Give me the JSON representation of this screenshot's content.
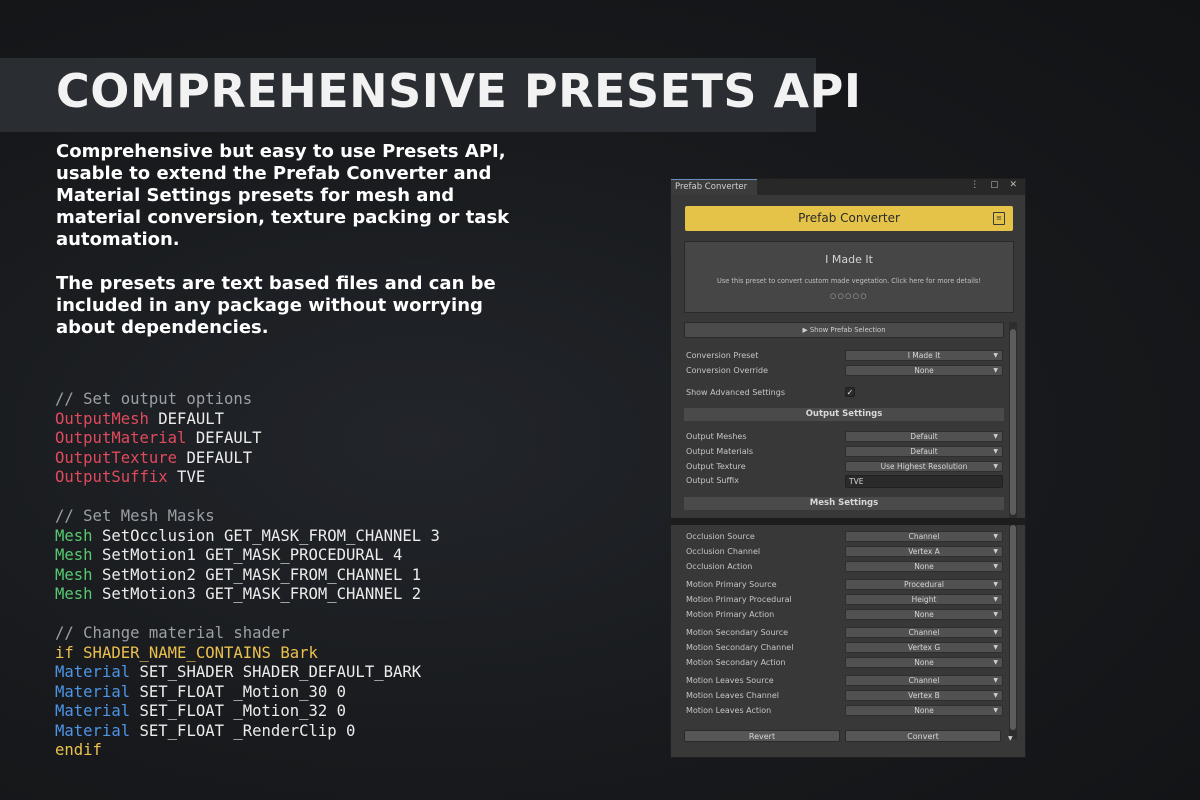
{
  "banner": {
    "title": "COMPREHENSIVE PRESETS API"
  },
  "description": {
    "paragraph1": "Comprehensive but easy to use Presets API, usable to extend the Prefab Converter and Material Settings presets for mesh and material conversion, texture packing or task automation.",
    "paragraph2": "The presets are text based files and can be included in any package without worrying about dependencies."
  },
  "code": [
    [
      {
        "t": "// Set output options",
        "c": "comment"
      }
    ],
    [
      {
        "t": "OutputMesh",
        "c": "red"
      },
      {
        "t": " DEFAULT",
        "c": "white"
      }
    ],
    [
      {
        "t": "OutputMaterial",
        "c": "red"
      },
      {
        "t": " DEFAULT",
        "c": "white"
      }
    ],
    [
      {
        "t": "OutputTexture",
        "c": "red"
      },
      {
        "t": " DEFAULT",
        "c": "white"
      }
    ],
    [
      {
        "t": "OutputSuffix",
        "c": "red"
      },
      {
        "t": " TVE",
        "c": "white"
      }
    ],
    [],
    [
      {
        "t": "// Set Mesh Masks",
        "c": "comment"
      }
    ],
    [
      {
        "t": "Mesh",
        "c": "green"
      },
      {
        "t": " SetOcclusion GET_MASK_FROM_CHANNEL 3",
        "c": "white"
      }
    ],
    [
      {
        "t": "Mesh",
        "c": "green"
      },
      {
        "t": " SetMotion1 GET_MASK_PROCEDURAL 4",
        "c": "white"
      }
    ],
    [
      {
        "t": "Mesh",
        "c": "green"
      },
      {
        "t": " SetMotion2 GET_MASK_FROM_CHANNEL 1",
        "c": "white"
      }
    ],
    [
      {
        "t": "Mesh",
        "c": "green"
      },
      {
        "t": " SetMotion3 GET_MASK_FROM_CHANNEL 2",
        "c": "white"
      }
    ],
    [],
    [
      {
        "t": "// Change material shader",
        "c": "comment"
      }
    ],
    [
      {
        "t": "if SHADER_NAME_CONTAINS Bark",
        "c": "yellow"
      }
    ],
    [
      {
        "t": "Material",
        "c": "blue"
      },
      {
        "t": " SET_SHADER SHADER_DEFAULT_BARK",
        "c": "white"
      }
    ],
    [
      {
        "t": "Material",
        "c": "blue"
      },
      {
        "t": " SET_FLOAT _Motion_30 0",
        "c": "white"
      }
    ],
    [
      {
        "t": "Material",
        "c": "blue"
      },
      {
        "t": " SET_FLOAT _Motion_32 0",
        "c": "white"
      }
    ],
    [
      {
        "t": "Material",
        "c": "blue"
      },
      {
        "t": " SET_FLOAT _RenderClip 0",
        "c": "white"
      }
    ],
    [
      {
        "t": "endif",
        "c": "yellow"
      }
    ]
  ],
  "window": {
    "tab_label": "Prefab Converter",
    "tab_icons": "⋮ ▢ ✕",
    "header_button": "Prefab Converter",
    "header_icon": "≡",
    "preset_title": "I Made It",
    "preset_desc": "Use this preset to convert custom made vegetation. Click here for more details!",
    "preset_dots": "○○○○○",
    "show_prefab_selection": "▶ Show Prefab Selection",
    "conversion_preset_label": "Conversion Preset",
    "conversion_preset_value": "I Made It",
    "conversion_override_label": "Conversion Override",
    "conversion_override_value": "None",
    "show_advanced_label": "Show Advanced Settings",
    "show_advanced_checked": "✓",
    "output_settings_header": "Output Settings",
    "output_meshes_label": "Output Meshes",
    "output_meshes_value": "Default",
    "output_materials_label": "Output Materials",
    "output_materials_value": "Default",
    "output_texture_label": "Output Texture",
    "output_texture_value": "Use Highest Resolution",
    "output_suffix_label": "Output Suffix",
    "output_suffix_value": "TVE",
    "mesh_settings_header": "Mesh Settings",
    "mesh_rows": [
      {
        "label": "Occlusion Source",
        "value": "Channel"
      },
      {
        "label": "Occlusion Channel",
        "value": "Vertex A"
      },
      {
        "label": "Occlusion Action",
        "value": "None"
      },
      {
        "label": "Motion Primary Source",
        "value": "Procedural"
      },
      {
        "label": "Motion Primary Procedural",
        "value": "Height"
      },
      {
        "label": "Motion Primary Action",
        "value": "None"
      },
      {
        "label": "Motion Secondary Source",
        "value": "Channel"
      },
      {
        "label": "Motion Secondary Channel",
        "value": "Vertex G"
      },
      {
        "label": "Motion Secondary Action",
        "value": "None"
      },
      {
        "label": "Motion Leaves Source",
        "value": "Channel"
      },
      {
        "label": "Motion Leaves Channel",
        "value": "Vertex B"
      },
      {
        "label": "Motion Leaves Action",
        "value": "None"
      }
    ],
    "revert_button": "Revert",
    "convert_button": "Convert",
    "dropdown_arrow": "▼",
    "scroll_arrow": "▼"
  }
}
